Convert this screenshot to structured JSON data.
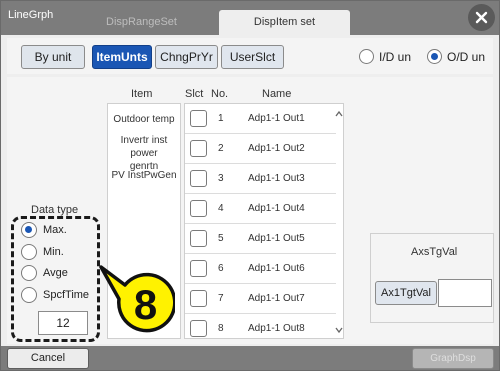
{
  "window": {
    "title": "LineGrph",
    "tabs": [
      {
        "label": "DispRangeSet",
        "active": false
      },
      {
        "label": "DispItem set",
        "active": true
      }
    ],
    "close_icon": "close-icon"
  },
  "toolbar": {
    "buttons": [
      {
        "label": "By unit",
        "selected": false
      },
      {
        "label": "ItemUnts",
        "selected": true
      },
      {
        "label": "ChngPrYr",
        "selected": false
      },
      {
        "label": "UserSlct",
        "selected": false
      }
    ],
    "io_options": [
      {
        "label": "I/D un",
        "selected": false
      },
      {
        "label": "O/D un",
        "selected": true
      }
    ]
  },
  "list": {
    "headers": {
      "item": "Item",
      "slct": "Slct",
      "no": "No.",
      "name": "Name"
    },
    "items": [
      "Outdoor temp",
      "Invertr inst power genrtn",
      "PV InstPwGen"
    ],
    "rows": [
      {
        "no": "1",
        "name": "Adp1-1 Out1",
        "checked": false
      },
      {
        "no": "2",
        "name": "Adp1-1 Out2",
        "checked": false
      },
      {
        "no": "3",
        "name": "Adp1-1 Out3",
        "checked": false
      },
      {
        "no": "4",
        "name": "Adp1-1 Out4",
        "checked": false
      },
      {
        "no": "5",
        "name": "Adp1-1 Out5",
        "checked": false
      },
      {
        "no": "6",
        "name": "Adp1-1 Out6",
        "checked": false
      },
      {
        "no": "7",
        "name": "Adp1-1 Out7",
        "checked": false
      },
      {
        "no": "8",
        "name": "Adp1-1 Out8",
        "checked": false
      }
    ]
  },
  "data_type": {
    "label": "Data type",
    "options": [
      {
        "label": "Max.",
        "selected": true
      },
      {
        "label": "Min.",
        "selected": false
      },
      {
        "label": "Avge",
        "selected": false
      },
      {
        "label": "SpcfTime",
        "selected": false
      }
    ],
    "spcf_value": "12"
  },
  "callout": {
    "number": "8"
  },
  "axs": {
    "title": "AxsTgVal",
    "button_label": "Ax1TgtVal",
    "value": ""
  },
  "bottom": {
    "cancel_label": "Cancel",
    "graph_label": "GraphDsp"
  },
  "colors": {
    "accent": "#1a56b4",
    "bar": "#7c7c7c"
  }
}
